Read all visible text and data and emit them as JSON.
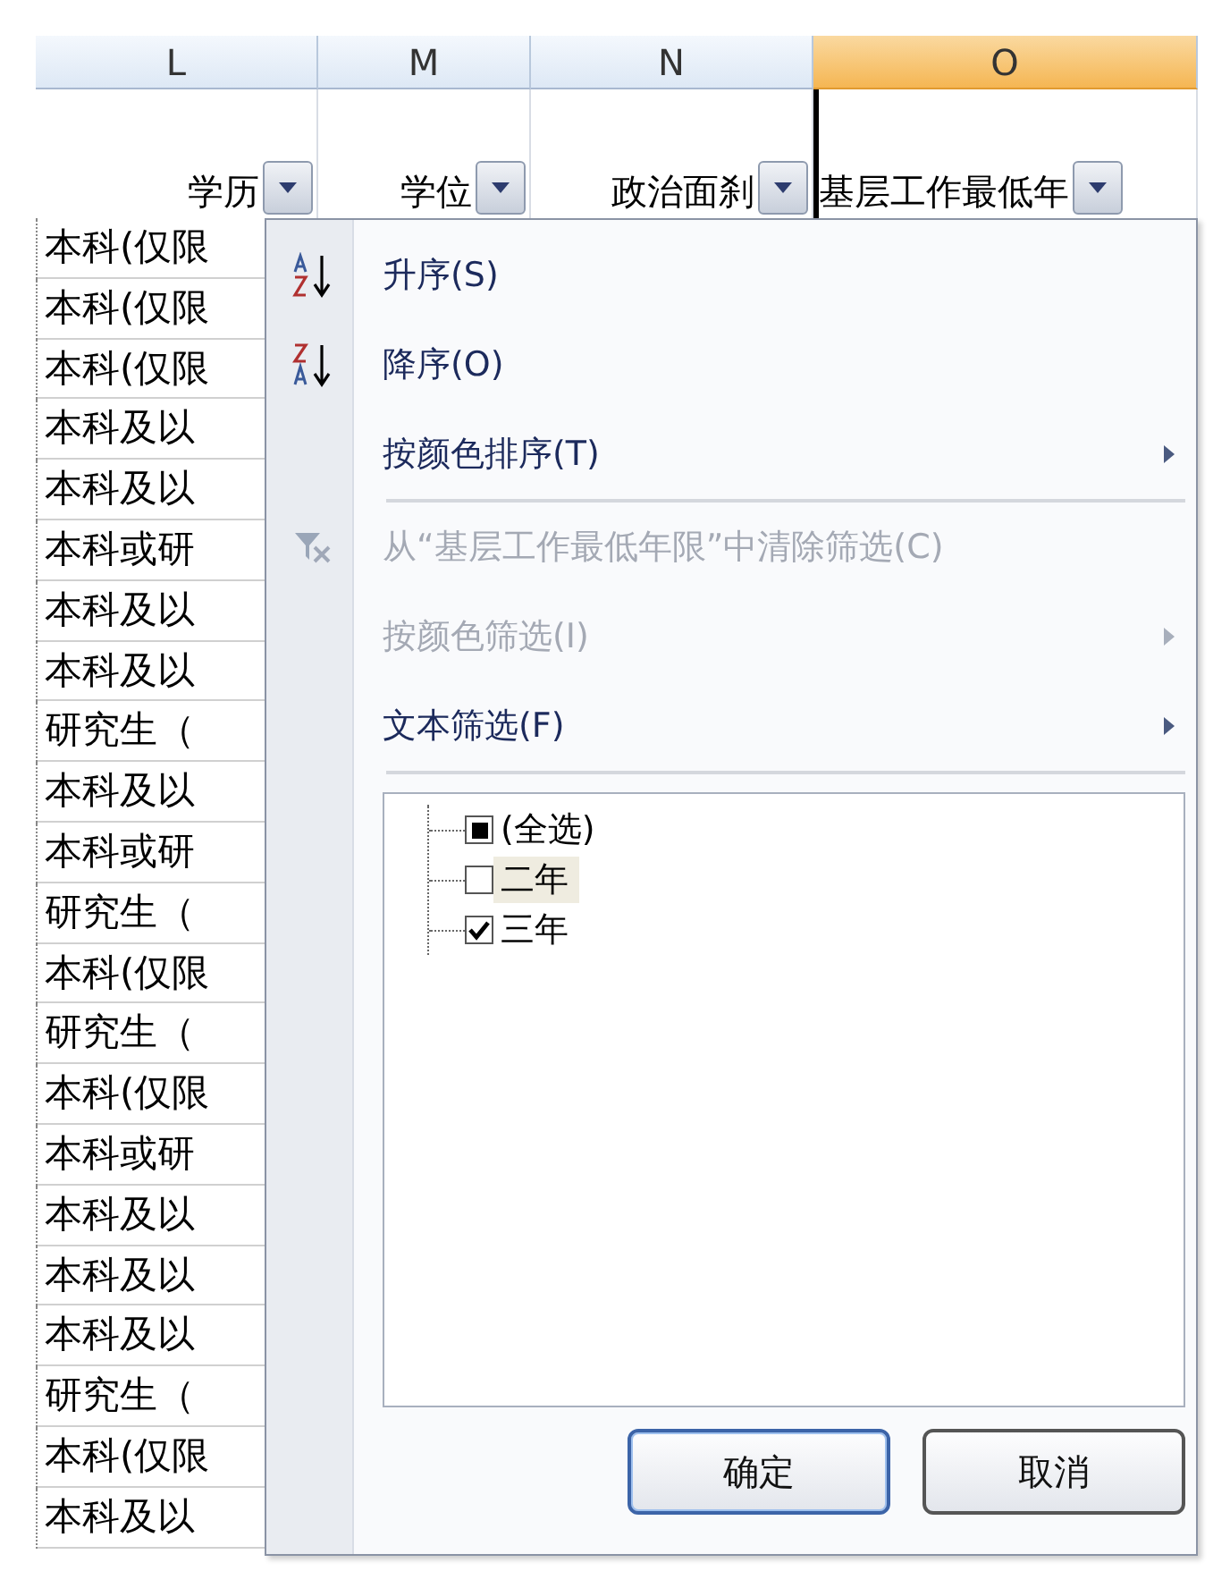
{
  "columns": [
    {
      "letter": "L",
      "selected": false
    },
    {
      "letter": "M",
      "selected": false
    },
    {
      "letter": "N",
      "selected": false
    },
    {
      "letter": "O",
      "selected": true
    }
  ],
  "headers": [
    {
      "label": "学历"
    },
    {
      "label": "学位"
    },
    {
      "label": "政治面刹"
    },
    {
      "label": "基层工作最低年"
    }
  ],
  "rows": [
    "本科(仅限",
    "本科(仅限",
    "本科(仅限",
    "本科及以",
    "本科及以",
    "本科或研",
    "本科及以",
    "本科及以",
    "研究生（",
    "本科及以",
    "本科或研",
    "研究生（",
    "本科(仅限",
    "研究生（",
    "本科(仅限",
    "本科或研",
    "本科及以",
    "本科及以",
    "本科及以",
    "研究生（",
    "本科(仅限",
    "本科及以"
  ],
  "menu": {
    "items": [
      {
        "kind": "sort-ascending",
        "label": "升序(S)",
        "disabled": false,
        "submenu": false
      },
      {
        "kind": "sort-descending",
        "label": "降序(O)",
        "disabled": false,
        "submenu": false
      },
      {
        "kind": "plain",
        "label": "按颜色排序(T)",
        "disabled": false,
        "submenu": true
      },
      {
        "kind": "separator"
      },
      {
        "kind": "clear-filter",
        "label": "从“基层工作最低年限”中清除筛选(C)",
        "disabled": true,
        "submenu": false
      },
      {
        "kind": "plain",
        "label": "按颜色筛选(I)",
        "disabled": true,
        "submenu": true
      },
      {
        "kind": "plain",
        "label": "文本筛选(F)",
        "disabled": false,
        "submenu": true
      },
      {
        "kind": "separator"
      }
    ],
    "values": [
      {
        "label": "(全选)",
        "checked": false,
        "partial": true,
        "focused": false
      },
      {
        "label": "二年",
        "checked": false,
        "partial": false,
        "focused": true
      },
      {
        "label": "三年",
        "checked": true,
        "partial": false,
        "focused": false
      }
    ],
    "buttons": [
      "确定",
      "取消"
    ]
  }
}
